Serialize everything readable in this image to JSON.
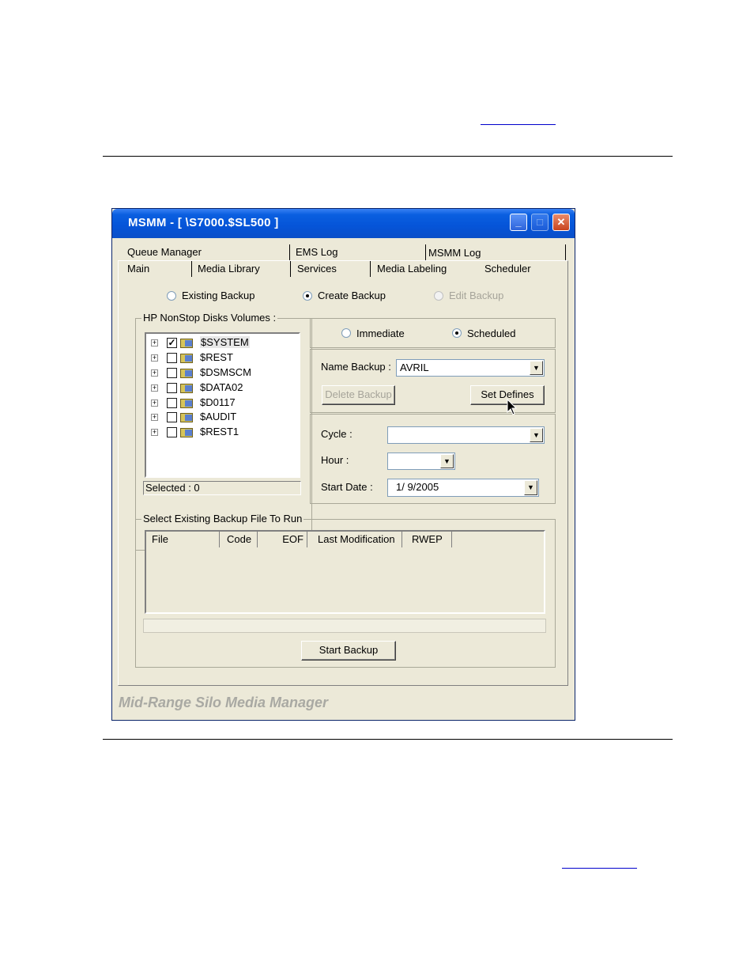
{
  "window": {
    "title": "MSMM - [ \\S7000.$SL500 ]",
    "minimize_label": "_",
    "maximize_label": "□",
    "close_label": "✕",
    "footer": "Mid-Range Silo Media Manager"
  },
  "tabs_row1": [
    "Queue Manager",
    "EMS Log",
    "MSMM Log"
  ],
  "tabs_row2": [
    "Main",
    "Media Library",
    "Services",
    "Media Labeling",
    "Scheduler"
  ],
  "active_tab": "Scheduler",
  "mode": {
    "existing_backup": "Existing Backup",
    "create_backup": "Create Backup",
    "edit_backup": "Edit Backup",
    "selected": "Create Backup"
  },
  "volumes": {
    "title": "HP NonStop Disks Volumes :",
    "items": [
      {
        "name": "$SYSTEM",
        "checked": true
      },
      {
        "name": "$REST",
        "checked": false
      },
      {
        "name": "$DSMSCM",
        "checked": false
      },
      {
        "name": "$DATA02",
        "checked": false
      },
      {
        "name": "$D0117",
        "checked": false
      },
      {
        "name": "$AUDIT",
        "checked": false
      },
      {
        "name": "$REST1",
        "checked": false
      }
    ],
    "status": "Selected : 0"
  },
  "run_mode": {
    "immediate": "Immediate",
    "scheduled": "Scheduled",
    "selected": "Scheduled"
  },
  "backup": {
    "name_label": "Name Backup :",
    "name_value": "AVRIL",
    "delete_button": "Delete Backup",
    "set_defines_button": "Set Defines"
  },
  "schedule": {
    "cycle_label": "Cycle :",
    "cycle_value": "",
    "hour_label": "Hour :",
    "hour_value": "",
    "start_date_label": "Start Date :",
    "start_date_value": "1/ 9/2005"
  },
  "existing_files": {
    "title": "Select Existing Backup File To Run",
    "columns": [
      "File",
      "Code",
      "EOF",
      "Last Modification",
      "RWEP"
    ],
    "rows": [],
    "start_button": "Start Backup"
  }
}
